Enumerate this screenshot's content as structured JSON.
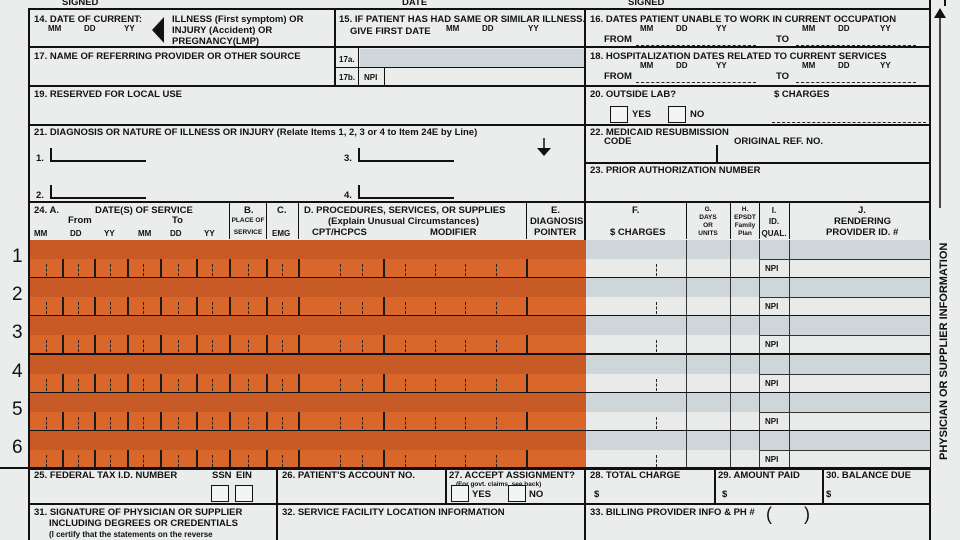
{
  "top": {
    "signed_left": "SIGNED",
    "date": "DATE",
    "signed_right": "SIGNED"
  },
  "b14": {
    "label": "14. DATE OF CURRENT:",
    "mm": "MM",
    "dd": "DD",
    "yy": "YY",
    "illness": "ILLNESS (First symptom) OR",
    "injury": "INJURY (Accident) OR",
    "pregnancy": "PREGNANCY(LMP)"
  },
  "b15": {
    "label": "15. IF PATIENT HAS HAD SAME OR SIMILAR ILLNESS.",
    "sub": "GIVE FIRST DATE",
    "mm": "MM",
    "dd": "DD",
    "yy": "YY"
  },
  "b16": {
    "label": "16. DATES PATIENT UNABLE TO WORK IN CURRENT OCCUPATION",
    "mm": "MM",
    "dd": "DD",
    "yy": "YY",
    "from": "FROM",
    "to": "TO"
  },
  "b17": {
    "label": "17. NAME OF REFERRING PROVIDER OR OTHER SOURCE",
    "a": "17a.",
    "b": "17b.",
    "npi": "NPI"
  },
  "b18": {
    "label": "18. HOSPITALIZATION DATES RELATED TO CURRENT SERVICES",
    "mm": "MM",
    "dd": "DD",
    "yy": "YY",
    "from": "FROM",
    "to": "TO"
  },
  "b19": {
    "label": "19. RESERVED FOR LOCAL USE"
  },
  "b20": {
    "label": "20. OUTSIDE LAB?",
    "charges": "$ CHARGES",
    "yes": "YES",
    "no": "NO"
  },
  "b21": {
    "label": "21. DIAGNOSIS OR NATURE OF ILLNESS OR INJURY (Relate Items 1, 2, 3 or 4 to Item 24E by Line)",
    "n1": "1.",
    "n2": "2.",
    "n3": "3.",
    "n4": "4."
  },
  "b22": {
    "label": "22. MEDICAID RESUBMISSION",
    "code": "CODE",
    "orig": "ORIGINAL REF. NO."
  },
  "b23": {
    "label": "23. PRIOR AUTHORIZATION NUMBER"
  },
  "b24": {
    "a": "24. A.",
    "dates": "DATE(S) OF SERVICE",
    "from": "From",
    "to": "To",
    "cols": [
      "MM",
      "DD",
      "YY",
      "MM",
      "DD",
      "YY"
    ],
    "b": "B.",
    "place": "PLACE OF",
    "service": "SERVICE",
    "c": "C.",
    "emg": "EMG",
    "d": "D. PROCEDURES, SERVICES, OR SUPPLIES",
    "d_sub": "(Explain Unusual Circumstances)",
    "cpt": "CPT/HCPCS",
    "modifier": "MODIFIER",
    "e": "E.",
    "diag": "DIAGNOSIS",
    "pointer": "POINTER",
    "f": "F.",
    "charges": "$ CHARGES",
    "g": "G.",
    "days": "DAYS",
    "or": "OR",
    "units": "UNITS",
    "h": "H.",
    "epsdt": "EPSDT",
    "family": "Family",
    "plan": "Plan",
    "i": "I.",
    "id": "ID.",
    "qual": "QUAL.",
    "j": "J.",
    "rendering": "RENDERING",
    "provider": "PROVIDER ID. #",
    "rows": [
      {
        "num": "1",
        "npi": "NPI"
      },
      {
        "num": "2",
        "npi": "NPI"
      },
      {
        "num": "3",
        "npi": "NPI"
      },
      {
        "num": "4",
        "npi": "NPI"
      },
      {
        "num": "5",
        "npi": "NPI"
      },
      {
        "num": "6",
        "npi": "NPI"
      }
    ]
  },
  "b25": {
    "label": "25. FEDERAL TAX I.D. NUMBER",
    "ssn": "SSN",
    "ein": "EIN"
  },
  "b26": {
    "label": "26. PATIENT'S ACCOUNT NO."
  },
  "b27": {
    "label": "27. ACCEPT ASSIGNMENT?",
    "sub": "(For govt. claims, see back)",
    "yes": "YES",
    "no": "NO"
  },
  "b28": {
    "label": "28. TOTAL CHARGE",
    "dollar": "$"
  },
  "b29": {
    "label": "29. AMOUNT PAID",
    "dollar": "$"
  },
  "b30": {
    "label": "30. BALANCE DUE",
    "dollar": "$"
  },
  "b31": {
    "l1": "31. SIGNATURE OF PHYSICIAN OR SUPPLIER",
    "l2": "INCLUDING DEGREES OR CREDENTIALS",
    "l3": "(I certify that the statements on the reverse"
  },
  "b32": {
    "label": "32. SERVICE FACILITY LOCATION INFORMATION"
  },
  "b33": {
    "label": "33. BILLING PROVIDER INFO & PH #",
    "paren_open": "(",
    "paren_close": ")"
  },
  "side_label": "PHYSICIAN OR SUPPLIER INFORMATION",
  "colors": {
    "orange": "#d9662b",
    "blue": "#cfd6da",
    "ink": "#111111"
  }
}
